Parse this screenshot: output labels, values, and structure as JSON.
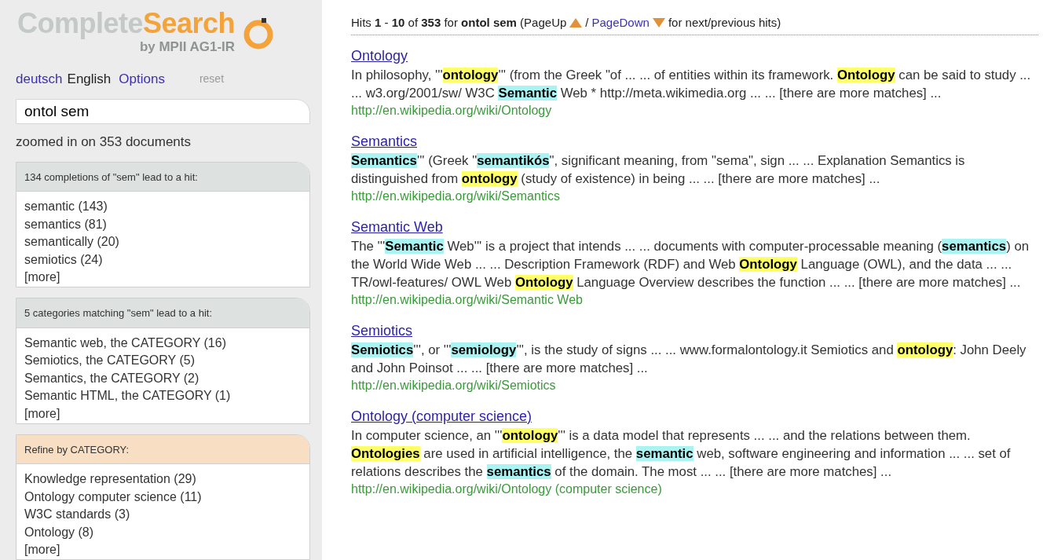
{
  "logo": {
    "part1": "Complete",
    "part2": "Search",
    "subtitle": "by MPII AG1-IR"
  },
  "languages": [
    {
      "label": "deutsch",
      "selected": false
    },
    {
      "label": "English",
      "selected": true
    }
  ],
  "options_link": "Options",
  "reset": {
    "label": "reset",
    "disabled": true
  },
  "search": {
    "value": "ontol sem"
  },
  "zoom_status": "zoomed in on 353 documents",
  "boxes": [
    {
      "kind": "completions",
      "title": "134 completions of \"sem\" lead to a hit:",
      "items": [
        "semantic (143)",
        "semantics (81)",
        "semantically (20)",
        "semiotics (24)",
        "[more]"
      ]
    },
    {
      "kind": "completions",
      "title": "5 categories matching \"sem\" lead to a hit:",
      "items": [
        "Semantic web, the CATEGORY (16)",
        "Semiotics, the CATEGORY (5)",
        "Semantics, the CATEGORY (2)",
        "Semantic HTML, the CATEGORY (1)",
        "[more]"
      ]
    },
    {
      "kind": "refine",
      "title": "Refine by CATEGORY:",
      "items": [
        "Knowledge representation (29)",
        "Ontology computer science (11)",
        "W3C standards (3)",
        "Ontology (8)",
        "[more]"
      ]
    }
  ],
  "hits_header": {
    "summary": "Hits **1** - **10** of **353** for **ontol sem** (PageUp",
    "separator": "/",
    "page_down": "PageDown",
    "tail": "for next/previous hits)"
  },
  "results": [
    {
      "title": "Ontology",
      "snippet": [
        {
          "kind": "plain",
          "text": "In philosophy, '''"
        },
        {
          "kind": "ontol",
          "text": "ontology"
        },
        {
          "kind": "plain",
          "text": "''' (from the Greek \"of ... ... of entities within its framework. "
        },
        {
          "kind": "ontol",
          "text": "Ontology"
        },
        {
          "kind": "plain",
          "text": " can be said to study ... ... w3.org/2001/sw/ W3C "
        },
        {
          "kind": "sem",
          "text": "Semantic"
        },
        {
          "kind": "plain",
          "text": " Web * http://meta.wikimedia.org ... ... [there are more matches] ..."
        }
      ],
      "url": "http://en.wikipedia.org/wiki/Ontology"
    },
    {
      "title": "Semantics",
      "snippet": [
        {
          "kind": "sem",
          "text": "Semantics"
        },
        {
          "kind": "plain",
          "text": "''' (Greek \""
        },
        {
          "kind": "sem",
          "text": "semantikós"
        },
        {
          "kind": "plain",
          "text": "\", significant meaning, from \"sema\", sign ... ... Explanation Semantics is distinguished from "
        },
        {
          "kind": "ontol",
          "text": "ontology"
        },
        {
          "kind": "plain",
          "text": " (study of existence) in being ... ... [there are more matches] ..."
        }
      ],
      "url": "http://en.wikipedia.org/wiki/Semantics"
    },
    {
      "title": "Semantic Web",
      "snippet": [
        {
          "kind": "plain",
          "text": "The '''"
        },
        {
          "kind": "sem",
          "text": "Semantic"
        },
        {
          "kind": "plain",
          "text": " Web''' is a project that intends ... ... documents with computer-processable meaning ("
        },
        {
          "kind": "sem",
          "text": "semantics"
        },
        {
          "kind": "plain",
          "text": ") on the World Wide Web ... ... Description Framework (RDF) and Web "
        },
        {
          "kind": "ontol",
          "text": "Ontology"
        },
        {
          "kind": "plain",
          "text": " Language (OWL), and the data ... ... TR/owl-features/ OWL Web "
        },
        {
          "kind": "ontol",
          "text": "Ontology"
        },
        {
          "kind": "plain",
          "text": " Language Overview describes the function ... ... [there are more matches] ..."
        }
      ],
      "url": "http://en.wikipedia.org/wiki/Semantic Web"
    },
    {
      "title": "Semiotics",
      "snippet": [
        {
          "kind": "sem",
          "text": "Semiotics"
        },
        {
          "kind": "plain",
          "text": "''', or '''"
        },
        {
          "kind": "sem",
          "text": "semiology"
        },
        {
          "kind": "plain",
          "text": "''', is the study of signs ... ... www.formalontology.it Semiotics and "
        },
        {
          "kind": "ontol",
          "text": "ontology"
        },
        {
          "kind": "plain",
          "text": ": John Deely and John Poinsot ... ... [there are more matches] ..."
        }
      ],
      "url": "http://en.wikipedia.org/wiki/Semiotics"
    },
    {
      "title": "Ontology (computer science)",
      "snippet": [
        {
          "kind": "plain",
          "text": "In computer science, an '''"
        },
        {
          "kind": "ontol",
          "text": "ontology"
        },
        {
          "kind": "plain",
          "text": "''' is a data model that represents ... ... and the relations between them. "
        },
        {
          "kind": "ontol",
          "text": "Ontologies"
        },
        {
          "kind": "plain",
          "text": " are used in artificial intelligence, the "
        },
        {
          "kind": "sem",
          "text": "semantic"
        },
        {
          "kind": "plain",
          "text": " web, software engineering and information ... ... set of relations describes the "
        },
        {
          "kind": "sem",
          "text": "semantics"
        },
        {
          "kind": "plain",
          "text": " of the domain. The most ... ... [there are more matches] ..."
        }
      ],
      "url": "http://en.wikipedia.org/wiki/Ontology (computer science)"
    }
  ]
}
